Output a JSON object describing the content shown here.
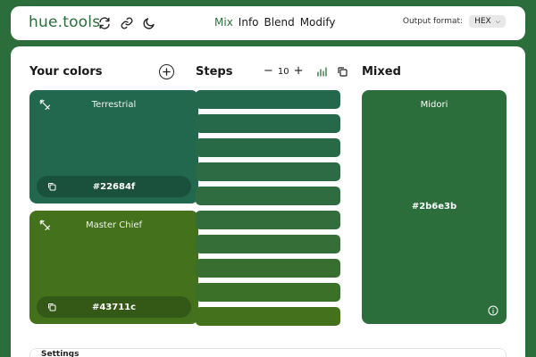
{
  "app": {
    "logo": "hue.tools",
    "icons": [
      "refresh-icon",
      "link-icon",
      "moon-icon"
    ]
  },
  "nav": {
    "items": [
      {
        "label": "Mix",
        "active": true
      },
      {
        "label": "Info",
        "active": false
      },
      {
        "label": "Blend",
        "active": false
      },
      {
        "label": "Modify",
        "active": false
      }
    ]
  },
  "output_format": {
    "label": "Output format:",
    "value": "HEX"
  },
  "your_colors": {
    "title": "Your colors",
    "colors": [
      {
        "name": "Terrestrial",
        "hex": "#22684f",
        "color": "#22684f"
      },
      {
        "name": "Master Chief",
        "hex": "#43711c",
        "color": "#43711c"
      }
    ]
  },
  "steps": {
    "title": "Steps",
    "count": "10",
    "colors": [
      "#23684d",
      "#26694a",
      "#296a46",
      "#2c6b43",
      "#2f6c3f",
      "#326d3b",
      "#356e37",
      "#386f30",
      "#3b7028",
      "#43711c"
    ]
  },
  "mixed": {
    "title": "Mixed",
    "name": "Midori",
    "hex": "#2b6e3b",
    "color": "#2b6e3b"
  },
  "settings": {
    "label": "Settings"
  }
}
